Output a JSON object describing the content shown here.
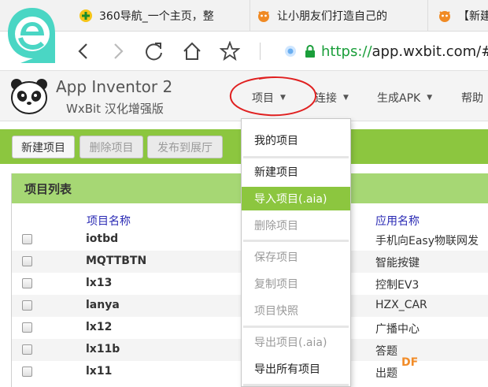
{
  "browser": {
    "tabs": [
      {
        "title": "360导航_一个主页，整"
      },
      {
        "title": "让小朋友们打造自己的"
      },
      {
        "title": "【新建"
      }
    ],
    "url": {
      "protocol": "https://",
      "host": "app.wxbit.com/#"
    }
  },
  "app": {
    "title": "App Inventor 2",
    "subtitle": "WxBit 汉化增强版",
    "menu": {
      "projects": "项目",
      "connect": "连接",
      "build": "生成APK",
      "help": "帮助"
    }
  },
  "toolbar": {
    "new_label": "新建项目",
    "delete_label": "删除项目",
    "publish_label": "发布到展厅"
  },
  "list": {
    "title": "项目列表",
    "col_name": "项目名称",
    "col_app": "应用名称",
    "rows": [
      {
        "name": "iotbd",
        "app": "手机向Easy物联网发"
      },
      {
        "name": "MQTTBTN",
        "app": "智能按键"
      },
      {
        "name": "lx13",
        "app": "控制EV3"
      },
      {
        "name": "lanya",
        "app": "HZX_CAR"
      },
      {
        "name": "lx12",
        "app": "广播中心"
      },
      {
        "name": "lx11b",
        "app": "答题"
      },
      {
        "name": "lx11",
        "app": "出题"
      }
    ]
  },
  "dropdown": {
    "items": [
      {
        "label": "我的项目",
        "state": "normal"
      },
      {
        "label": "新建项目",
        "state": "normal"
      },
      {
        "label": "导入项目(.aia)",
        "state": "active"
      },
      {
        "label": "删除项目",
        "state": "disabled"
      },
      {
        "label": "保存项目",
        "state": "disabled"
      },
      {
        "label": "复制项目",
        "state": "disabled"
      },
      {
        "label": "项目快照",
        "state": "disabled"
      },
      {
        "label": "导出项目(.aia)",
        "state": "disabled"
      },
      {
        "label": "导出所有项目",
        "state": "normal"
      }
    ]
  },
  "watermark": "DF",
  "colors": {
    "accent_green": "#8cc63f",
    "header_green": "#a6d774",
    "annotation_red": "#e02020",
    "url_green": "#1a9e3a"
  }
}
